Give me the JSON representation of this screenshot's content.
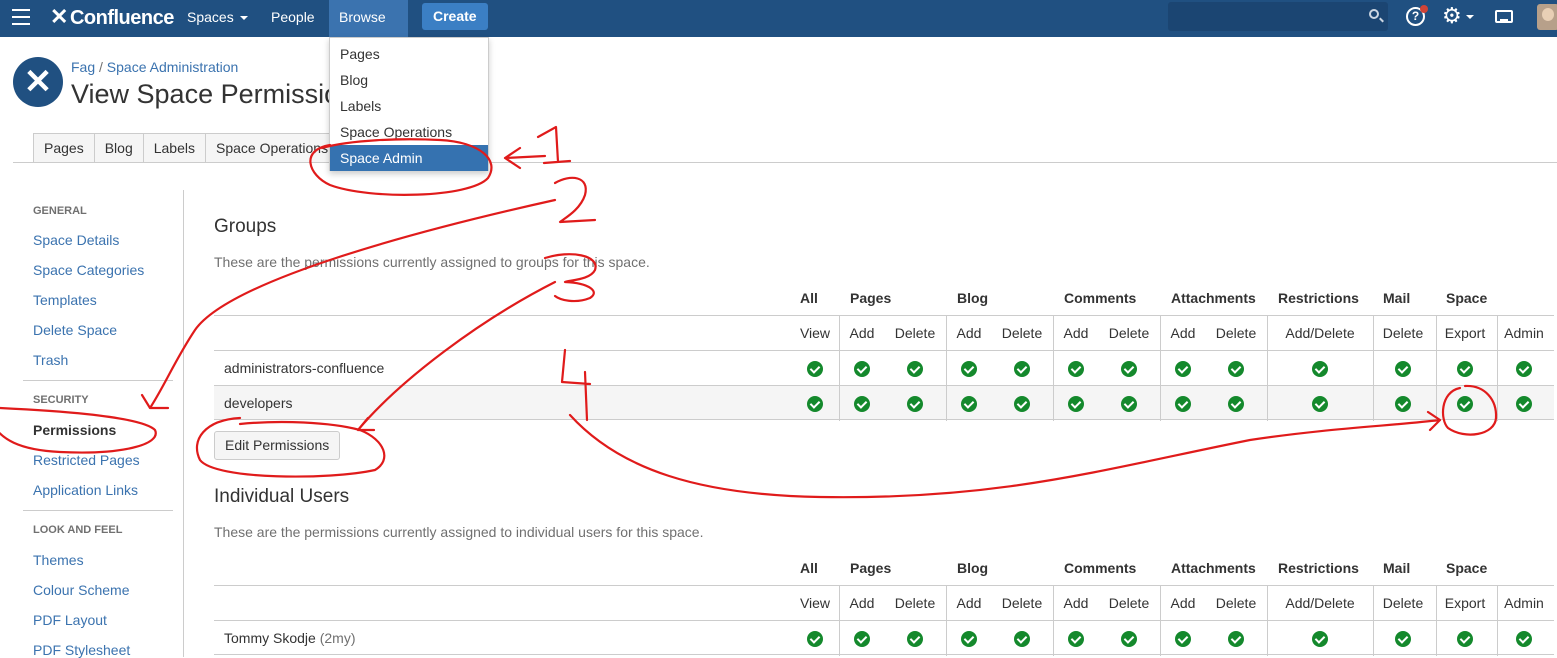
{
  "nav": {
    "brand": "Confluence",
    "spaces": "Spaces",
    "people": "People",
    "browse": "Browse",
    "create": "Create",
    "help": "?"
  },
  "browse_menu": [
    "Pages",
    "Blog",
    "Labels",
    "Space Operations",
    "Space Admin"
  ],
  "breadcrumb": {
    "space": "Fag",
    "sep": "/",
    "section": "Space Administration"
  },
  "page_title": "View Space Permissions",
  "tabs": [
    "Pages",
    "Blog",
    "Labels",
    "Space Operations"
  ],
  "sidebar": {
    "general": "GENERAL",
    "general_items": [
      "Space Details",
      "Space Categories",
      "Templates",
      "Delete Space",
      "Trash"
    ],
    "security": "SECURITY",
    "security_items": [
      "Permissions",
      "Restricted Pages",
      "Application Links"
    ],
    "look": "LOOK AND FEEL",
    "look_items": [
      "Themes",
      "Colour Scheme",
      "PDF Layout",
      "PDF Stylesheet"
    ]
  },
  "groups": {
    "title": "Groups",
    "desc": "These are the permissions currently assigned to groups for this space.",
    "rows": [
      "administrators-confluence",
      "developers"
    ],
    "edit_button": "Edit Permissions"
  },
  "users": {
    "title": "Individual Users",
    "desc": "These are the permissions currently assigned to individual users for this space.",
    "rows": [
      {
        "name": "Tommy Skodje",
        "extra": "(2my)"
      }
    ]
  },
  "perm_headers": [
    "All",
    "Pages",
    "Blog",
    "Comments",
    "Attachments",
    "Restrictions",
    "Mail",
    "Space"
  ],
  "perm_subheaders": [
    "View",
    "Add",
    "Delete",
    "Add",
    "Delete",
    "Add",
    "Delete",
    "Add",
    "Delete",
    "Add/Delete",
    "Delete",
    "Export",
    "Admin"
  ],
  "annotations": [
    "1",
    "2",
    "3",
    "4"
  ],
  "colors": {
    "header": "#205081",
    "link": "#3b73af",
    "check": "#14892c",
    "annotation": "#e01b1b"
  }
}
